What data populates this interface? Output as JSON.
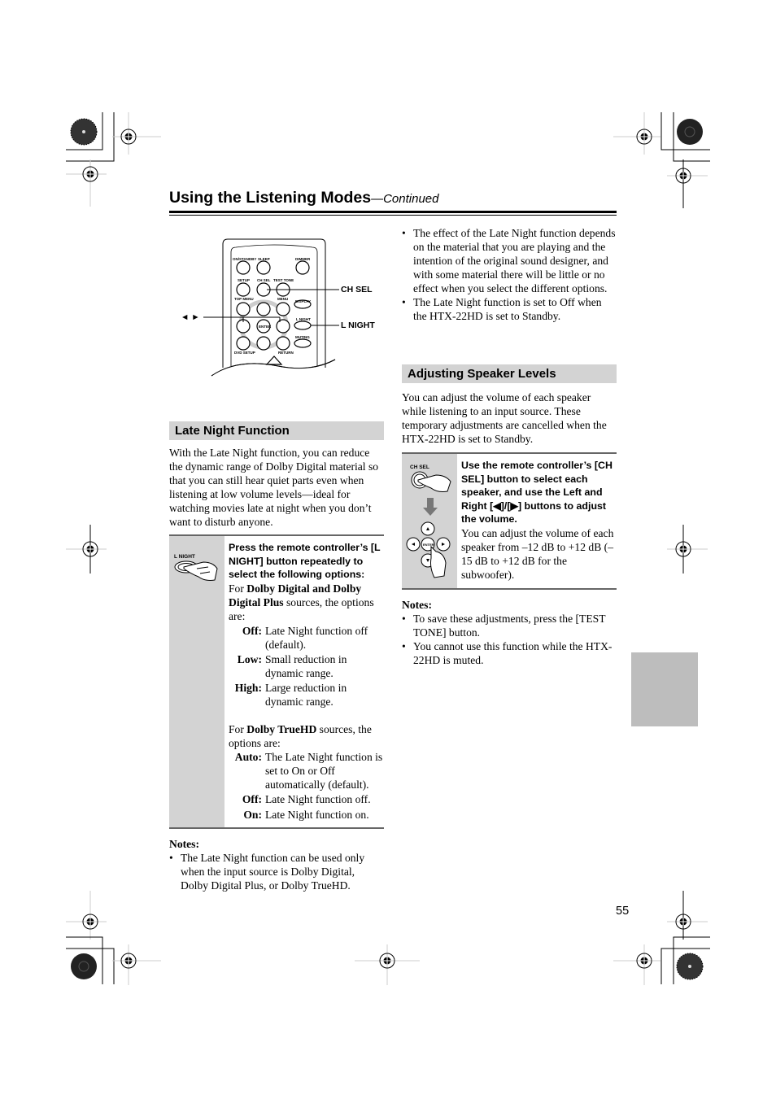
{
  "header": {
    "title": "Using the Listening Modes",
    "continued": "—Continued"
  },
  "remote_figure": {
    "callouts": {
      "ch_sel": "CH SEL",
      "l_night": "L NIGHT",
      "arrows": "◄ ►"
    },
    "button_labels": [
      "ON/STANDBY",
      "SLEEP",
      "DIMMER",
      "SETUP",
      "CH SEL",
      "TEST TONE",
      "TOP MENU",
      "MENU",
      "DISPLAY",
      "L NIGHT",
      "ENTER",
      "MUTING",
      "DVD SETUP",
      "RETURN"
    ]
  },
  "late_night": {
    "heading": "Late Night Function",
    "intro": "With the Late Night function, you can reduce the dynamic range of Dolby Digital material so that you can still hear quiet parts even when listening at low volume levels—ideal for watching movies late at night when you don’t want to disturb anyone.",
    "step": {
      "icon_label": "L NIGHT",
      "instruction": "Press the remote controller’s [L NIGHT] button repeatedly to select the following options:",
      "group1_prefix": "For ",
      "group1_bold": "Dolby Digital and Dolby Digital Plus",
      "group1_suffix": " sources, the options are:",
      "group1_options": [
        {
          "key": "Off:",
          "value": "Late Night function off (default)."
        },
        {
          "key": "Low:",
          "value": "Small reduction in dynamic range."
        },
        {
          "key": "High:",
          "value": "Large reduction in dynamic range."
        }
      ],
      "group2_prefix": "For ",
      "group2_bold": "Dolby TrueHD",
      "group2_suffix": " sources, the options are:",
      "group2_options": [
        {
          "key": "Auto:",
          "value": "The Late Night function is set to On or Off automatically (default)."
        },
        {
          "key": "Off:",
          "value": "Late Night function off."
        },
        {
          "key": "On:",
          "value": "Late Night function on."
        }
      ]
    },
    "notes_title": "Notes:",
    "notes": [
      "The Late Night function can be used only when the input source is Dolby Digital, Dolby Digital Plus, or Dolby TrueHD."
    ]
  },
  "right_bullets": [
    "The effect of the Late Night function depends on the material that you are playing and the intention of the original sound designer, and with some material there will be little or no effect when you select the different options.",
    "The Late Night function is set to Off when the HTX-22HD is set to Standby."
  ],
  "speaker_levels": {
    "heading": "Adjusting Speaker Levels",
    "intro": "You can adjust the volume of each speaker while listening to an input source. These temporary adjustments are cancelled when the HTX-22HD is set to Standby.",
    "step": {
      "icon_label": "CH SEL",
      "enter_label": "ENTER",
      "instruction": "Use the remote controller’s [CH SEL] button to select each speaker, and use the Left and Right [◀]/[▶] buttons to adjust the volume.",
      "detail": "You can adjust the volume of each speaker from –12 dB to +12 dB (–15 dB to +12 dB for the subwoofer)."
    },
    "notes_title": "Notes:",
    "notes": [
      "To save these adjustments, press the [TEST TONE] button.",
      "You cannot use this function while the HTX-22HD is muted."
    ]
  },
  "page_number": "55"
}
